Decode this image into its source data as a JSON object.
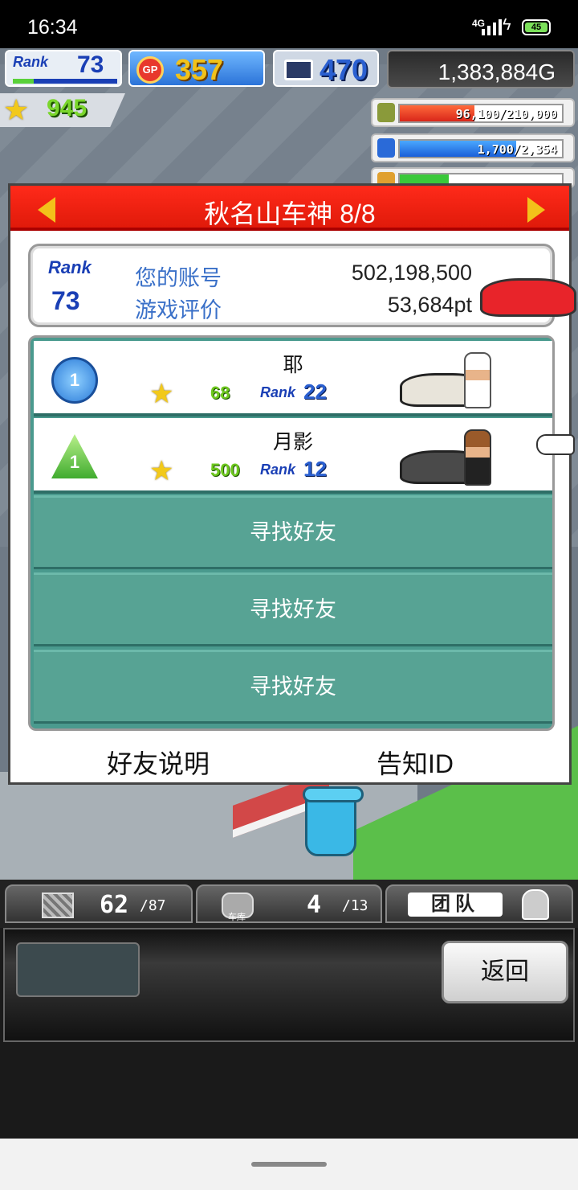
{
  "status_bar": {
    "time": "16:34",
    "network": "4G",
    "battery": "45"
  },
  "hud": {
    "rank_label": "Rank",
    "rank_value": "73",
    "rank_progress": 0.2,
    "gp_icon_label": "GP",
    "gp_value": "357",
    "research_value": "470",
    "money": "1,383,884G",
    "stars": "945"
  },
  "resources": {
    "money_bar": {
      "text": "96,100/210,000",
      "fill": 0.46
    },
    "fuel_bar": {
      "text": "1,700/2,354",
      "fill": 0.72
    },
    "third_bar": {
      "fill": 0.3
    }
  },
  "dialog": {
    "title": "秋名山车神 8/8",
    "rank_label": "Rank",
    "rank_value": "73",
    "account_label": "您的账号",
    "account_value": "502,198,500",
    "rating_label": "游戏评价",
    "rating_value": "53,684pt",
    "friends": [
      {
        "badge": "1",
        "name": "耶",
        "stars": "68",
        "rank_label": "Rank",
        "rank": "22"
      },
      {
        "badge": "1",
        "name": "月影",
        "stars": "500",
        "rank_label": "Rank",
        "rank": "12"
      }
    ],
    "find_friend": [
      "寻找好友",
      "寻找好友",
      "寻找好友"
    ],
    "footer": {
      "explain": "好友说明",
      "notify_id": "告知ID"
    }
  },
  "tabs": [
    {
      "count": "62",
      "total": "87"
    },
    {
      "label": "车库",
      "count": "4",
      "total": "13"
    },
    {
      "label": "团队"
    }
  ],
  "bottom": {
    "back_label": "返回"
  },
  "colors": {
    "header_red": "#ff2a1a",
    "teal": "#57a394",
    "rank_blue": "#1a3fb5",
    "star_gold": "#f2c91a"
  }
}
